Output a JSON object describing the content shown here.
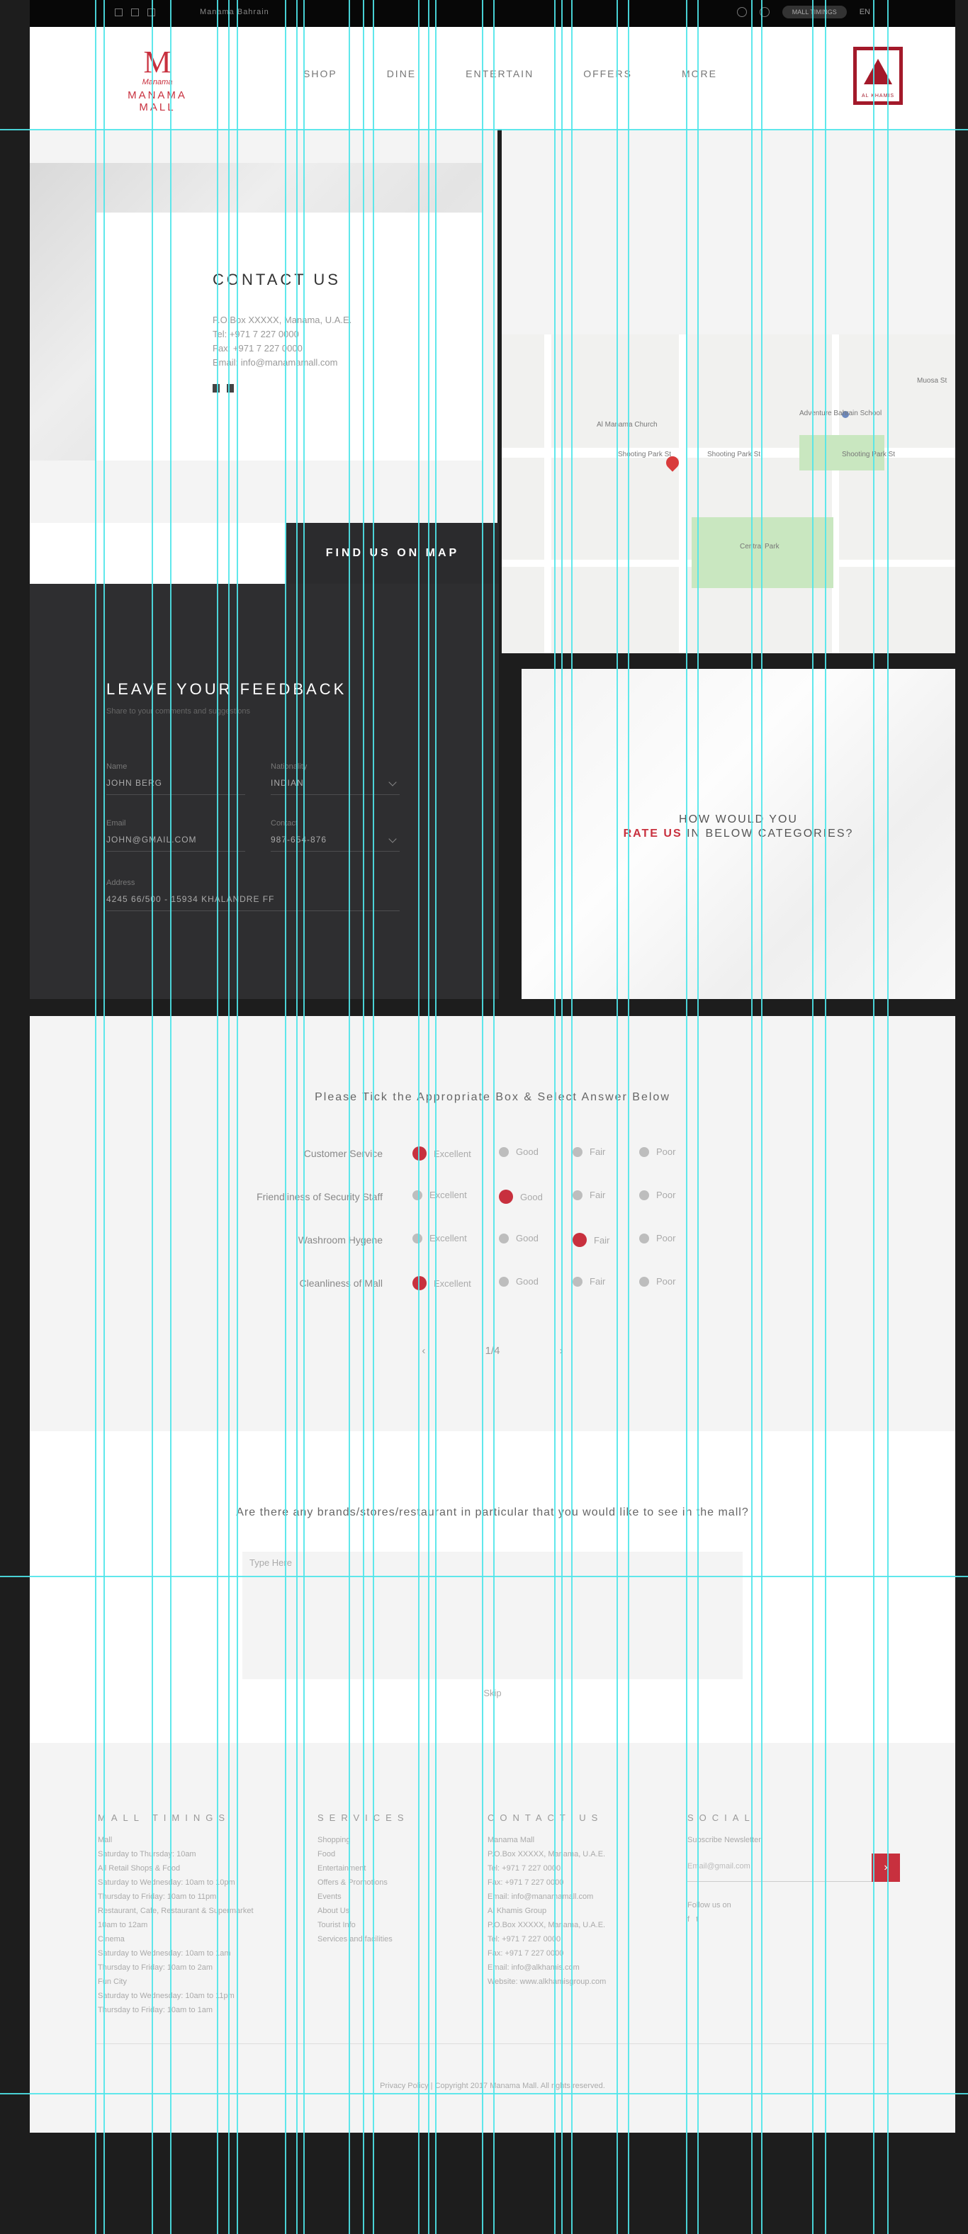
{
  "topbar": {
    "tagline": "Manama Bahrain",
    "mall_timings": "MALL TIMINGS",
    "language": "EN"
  },
  "header": {
    "logo_word": "MANAMA MALL",
    "logo_script": "Manama",
    "badge_text": "AL KHAMIS",
    "nav": [
      "SHOP",
      "DINE",
      "ENTERTAIN",
      "OFFERS",
      "MORE"
    ]
  },
  "contact": {
    "title": "CONTACT US",
    "lines": [
      "P.O.Box XXXXX, Manama, U.A.E.",
      "Tel: +971 7 227 0000",
      "Fax: +971 7 227 0000",
      "Email: info@manamamall.com"
    ],
    "find_button": "FIND US ON MAP"
  },
  "map": {
    "labels": [
      "Al Manama Church",
      "Adventure Bahrain School",
      "Shooting Park St",
      "Shooting Park St",
      "Shooting Park St",
      "Muosa St",
      "Central Park"
    ]
  },
  "feedback": {
    "title": "LEAVE YOUR FEEDBACK",
    "subtitle": "Share to your comments and suggestions",
    "name_label": "Name",
    "name_value": "JOHN BERG",
    "nationality_label": "Nationality",
    "nationality_value": "INDIAN",
    "email_label": "Email",
    "email_value": "JOHN@GMAIL.COM",
    "contact_label": "Contact",
    "contact_value": "987-654-876",
    "address_label": "Address",
    "address_value": "4245 66/500 - 15934 KHALANDRE FF"
  },
  "rate": {
    "line1": "HOW WOULD YOU",
    "line2_emph": "RATE US",
    "line2_rest": " IN BELOW CATEGORIES?"
  },
  "questions": {
    "heading": "Please Tick the Appropriate Box & Select Answer Below",
    "options": [
      "Excellent",
      "Good",
      "Fair",
      "Poor"
    ],
    "rows": [
      {
        "label": "Customer Service",
        "selected": 0
      },
      {
        "label": "Friendliness of Security Staff",
        "selected": 1
      },
      {
        "label": "Washroom Hygene",
        "selected": 2
      },
      {
        "label": "Cleanliness of Mall",
        "selected": 0
      }
    ],
    "pager": "1/4",
    "prev": "‹",
    "next": "›"
  },
  "brands": {
    "question": "Are there any brands/stores/restaurant in particular that you would like to see in the mall?",
    "placeholder": "Type Here",
    "next": "Skip"
  },
  "footer": {
    "col1": {
      "title": "MALL TIMINGS",
      "lines": [
        "Mall",
        "Saturday to Thursday: 10am",
        "All Retail Shops & Food",
        "Saturday to Wednesday: 10am to 10pm",
        "Thursday to Friday: 10am to 11pm",
        "Restaurant, Cafe, Restaurant & Supermarket",
        "10am to 12am",
        "Cinema",
        "Saturday to Wednesday: 10am to 1am",
        "Thursday to Friday: 10am to 2am",
        "Fun City",
        "Saturday to Wednesday: 10am to 11pm",
        "Thursday to Friday: 10am to 1am"
      ]
    },
    "col2": {
      "title": "SERVICES",
      "lines": [
        "Shopping",
        "Food",
        "Entertainment",
        "Offers & Promotions",
        "Events",
        "About Us",
        "Tourist Info",
        "Services and facilities"
      ]
    },
    "col3": {
      "title": "CONTACT US",
      "lines": [
        "Manama Mall",
        "P.O.Box XXXXX, Manama, U.A.E.",
        "Tel: +971 7 227 0000",
        "Fax: +971 7 227 0000",
        "Email: info@manamamall.com",
        "Al Khamis Group",
        "P.O.Box XXXXX, Manama, U.A.E.",
        "Tel: +971 7 227 0000",
        "Fax: +971 7 227 0000",
        "Email: info@alkhamis.com",
        "Website: www.alkhamisgroup.com"
      ]
    },
    "col4": {
      "title": "SOCIAL",
      "subscribe_label": "Subscribe Newsletter",
      "subscribe_placeholder": "Email@gmail.com",
      "follow": "Follow us on"
    },
    "copyright": "Privacy Policy | Copyright 2017 Manama Mall. All rights reserved."
  }
}
